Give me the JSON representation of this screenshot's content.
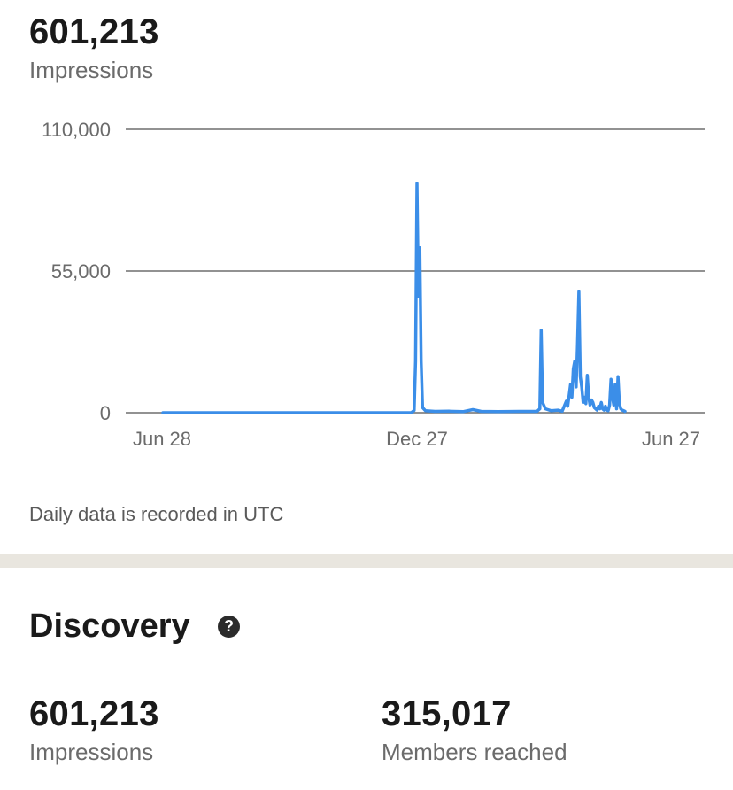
{
  "summary": {
    "value": "601,213",
    "label": "Impressions"
  },
  "chart_data": {
    "type": "line",
    "x_ticks": [
      "Jun 28",
      "Dec 27",
      "Jun 27"
    ],
    "y_ticks": [
      "110,000",
      "55,000",
      "0"
    ],
    "ylim": [
      0,
      110000
    ],
    "grid": true,
    "color": "#3b8ee8",
    "series": [
      {
        "values": [
          [
            0,
            0
          ],
          [
            60,
            0
          ],
          [
            120,
            0
          ],
          [
            175,
            0
          ],
          [
            178,
            0
          ],
          [
            180,
            900
          ],
          [
            181,
            20000
          ],
          [
            182,
            89000
          ],
          [
            183,
            45000
          ],
          [
            184,
            64000
          ],
          [
            185,
            20000
          ],
          [
            186,
            2000
          ],
          [
            188,
            800
          ],
          [
            195,
            500
          ],
          [
            205,
            600
          ],
          [
            215,
            400
          ],
          [
            222,
            1200
          ],
          [
            228,
            500
          ],
          [
            240,
            400
          ],
          [
            255,
            500
          ],
          [
            268,
            500
          ],
          [
            270,
            1500
          ],
          [
            271,
            32000
          ],
          [
            272,
            4000
          ],
          [
            274,
            1500
          ],
          [
            278,
            800
          ],
          [
            283,
            1000
          ],
          [
            286,
            600
          ],
          [
            289,
            4500
          ],
          [
            290,
            2500
          ],
          [
            292,
            11000
          ],
          [
            293,
            6000
          ],
          [
            294,
            17000
          ],
          [
            295,
            20000
          ],
          [
            296,
            10000
          ],
          [
            297,
            26000
          ],
          [
            298,
            47000
          ],
          [
            299,
            14000
          ],
          [
            300,
            10000
          ],
          [
            301,
            4000
          ],
          [
            302,
            6000
          ],
          [
            303,
            3500
          ],
          [
            304,
            14500
          ],
          [
            305,
            6000
          ],
          [
            306,
            3000
          ],
          [
            307,
            5000
          ],
          [
            308,
            4000
          ],
          [
            309,
            2000
          ],
          [
            310,
            1500
          ],
          [
            311,
            1000
          ],
          [
            312,
            2500
          ],
          [
            313,
            1500
          ],
          [
            314,
            4000
          ],
          [
            315,
            1500
          ],
          [
            316,
            1000
          ],
          [
            317,
            2500
          ],
          [
            318,
            1000
          ],
          [
            319,
            800
          ],
          [
            320,
            3000
          ],
          [
            321,
            13000
          ],
          [
            322,
            6000
          ],
          [
            323,
            3000
          ],
          [
            324,
            11000
          ],
          [
            325,
            1500
          ],
          [
            326,
            14000
          ],
          [
            327,
            3500
          ],
          [
            328,
            1500
          ],
          [
            329,
            1000
          ],
          [
            330,
            800
          ],
          [
            331,
            500
          ]
        ]
      }
    ],
    "x_range": [
      0,
      364
    ]
  },
  "footnote": "Daily data is recorded in UTC",
  "discovery": {
    "title": "Discovery",
    "help_glyph": "?",
    "stats": [
      {
        "value": "601,213",
        "label": "Impressions"
      },
      {
        "value": "315,017",
        "label": "Members reached"
      }
    ]
  }
}
